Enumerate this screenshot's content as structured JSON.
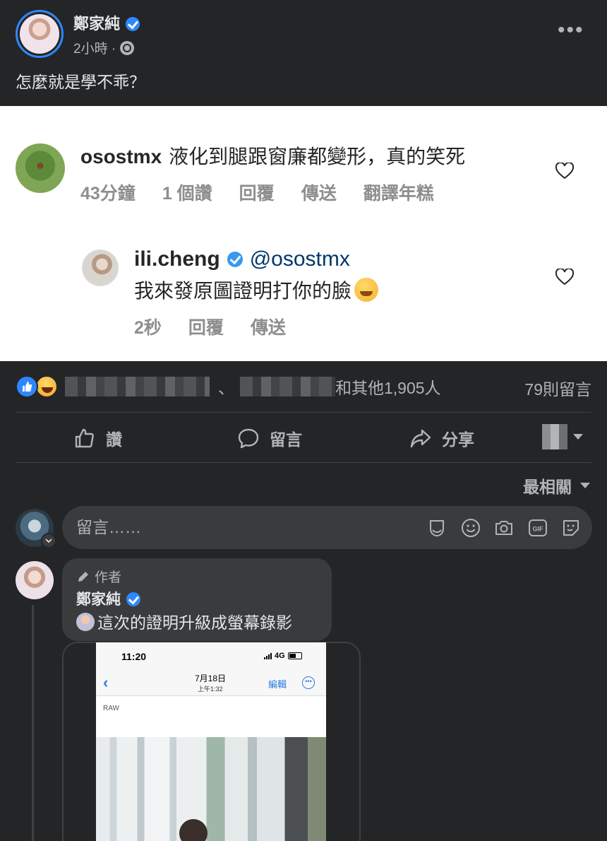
{
  "post": {
    "author_name": "鄭家純",
    "time": "2小時 ·",
    "text": "怎麼就是學不乖？",
    "more_icon": "more-dots-icon"
  },
  "embedded_screenshot": {
    "comment1": {
      "username": "osostmx",
      "text": "液化到腿跟窗廉都變形，真的笑死",
      "time": "43分鐘",
      "likes": "1 個讚",
      "reply": "回覆",
      "send": "傳送",
      "translate": "翻譯年糕"
    },
    "comment2": {
      "username": "ili.cheng",
      "mention": "@osostmx",
      "text": "我來發原圖證明打你的臉",
      "time": "2秒",
      "reply": "回覆",
      "send": "傳送"
    }
  },
  "reactions": {
    "separator": "、",
    "others": "和其他1,905人",
    "comment_count": "79則留言"
  },
  "actions": {
    "like": "讚",
    "comment": "留言",
    "share": "分享"
  },
  "sort": {
    "label": "最相關"
  },
  "comment_input": {
    "placeholder": "留言……"
  },
  "author_comment": {
    "role": "作者",
    "name": "鄭家純",
    "text": "這次的證明升級成螢幕錄影"
  },
  "attachment": {
    "status_time": "11:20",
    "network": "4G",
    "date": "7月18日",
    "date_sub": "上午1:32",
    "edit": "編輯",
    "label": "RAW"
  },
  "colors": {
    "background": "#242526",
    "accent": "#2d88ff",
    "text_secondary": "#b0b3b8"
  }
}
